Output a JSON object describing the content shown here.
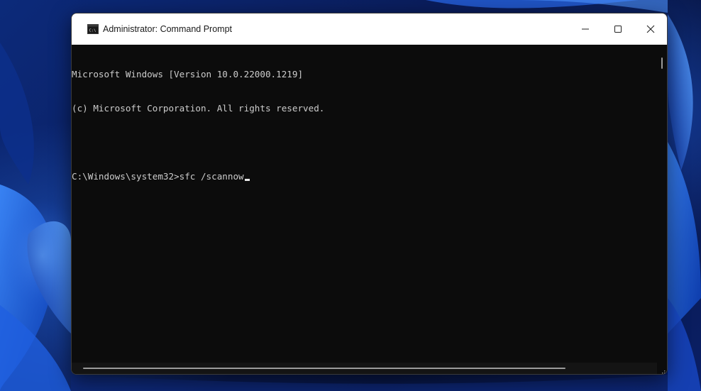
{
  "window": {
    "title": "Administrator: Command Prompt",
    "icon": "cmd-icon",
    "controls": [
      "minimize-icon",
      "maximize-icon",
      "close-icon"
    ]
  },
  "console": {
    "lines": [
      "Microsoft Windows [Version 10.0.22000.1219]",
      "(c) Microsoft Corporation. All rights reserved.",
      "",
      "C:\\Windows\\system32>sfc /scannow"
    ]
  },
  "colors": {
    "terminal_bg": "#0c0c0c",
    "terminal_fg": "#cccccc",
    "titlebar_bg": "#ffffff"
  }
}
